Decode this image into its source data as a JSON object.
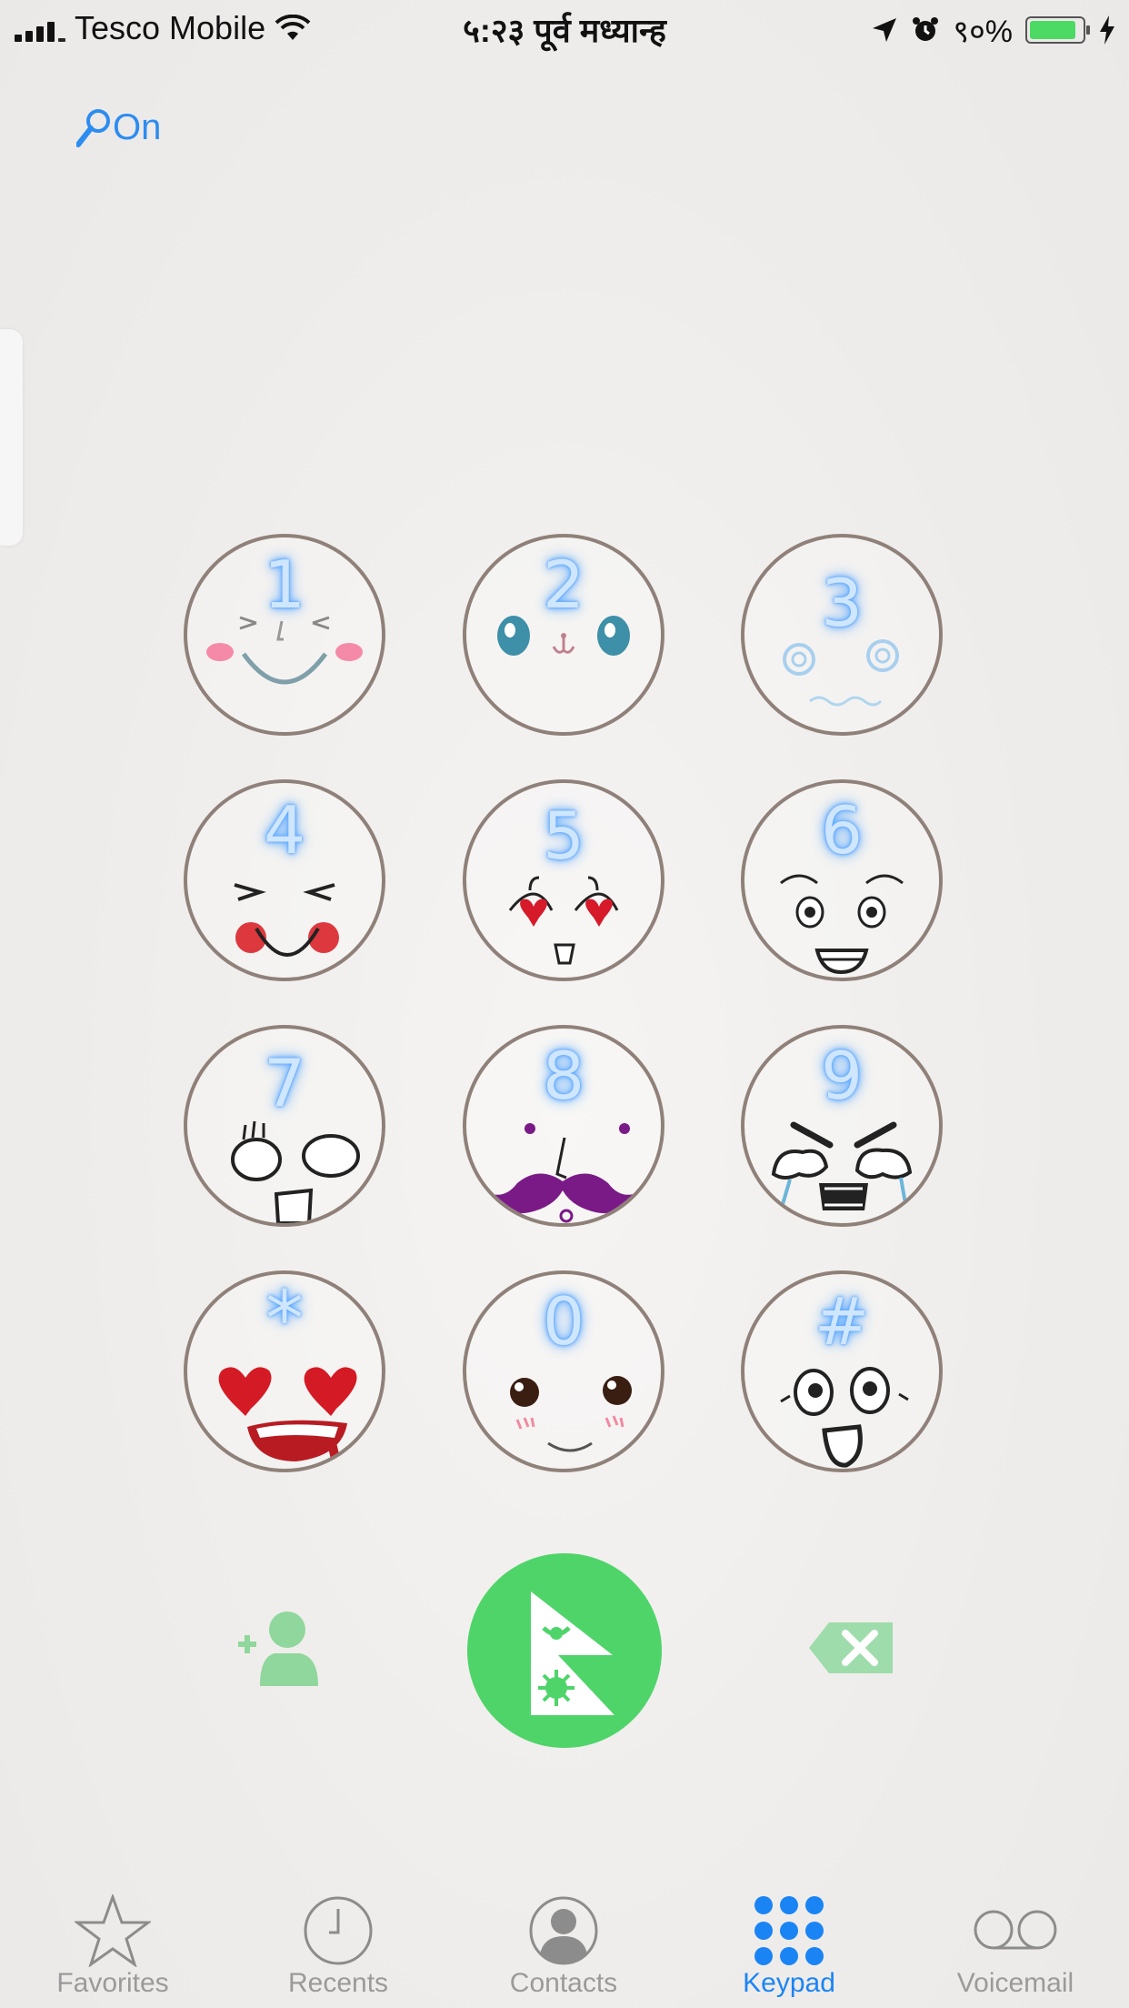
{
  "status_bar": {
    "carrier": "Tesco Mobile",
    "time": "५:२३ पूर्व मध्यान्ह",
    "battery_text": "९०%",
    "battery_level": 0.9
  },
  "search_toggle": {
    "label": "On"
  },
  "keypad": {
    "keys": [
      {
        "digit": "1",
        "face": "happy-squint-face"
      },
      {
        "digit": "2",
        "face": "cute-eyes-face"
      },
      {
        "digit": "3",
        "face": "dizzy-face"
      },
      {
        "digit": "4",
        "face": "blushing-grin-face"
      },
      {
        "digit": "5",
        "face": "heart-eyes-face"
      },
      {
        "digit": "6",
        "face": "grinning-face"
      },
      {
        "digit": "7",
        "face": "shocked-face"
      },
      {
        "digit": "8",
        "face": "mustache-face"
      },
      {
        "digit": "9",
        "face": "angry-crying-face"
      },
      {
        "digit": "*",
        "face": "love-drool-face"
      },
      {
        "digit": "0",
        "face": "blushing-face"
      },
      {
        "digit": "#",
        "face": "surprised-face"
      }
    ]
  },
  "actions": {
    "add_contact_icon": "add-contact-icon",
    "call_icon": "nepal-flag-icon",
    "delete_icon": "delete-icon",
    "call_color": "#4fd46a"
  },
  "tabs": [
    {
      "label": "Favorites",
      "icon": "star-icon"
    },
    {
      "label": "Recents",
      "icon": "clock-icon"
    },
    {
      "label": "Contacts",
      "icon": "contact-icon"
    },
    {
      "label": "Keypad",
      "icon": "keypad-icon",
      "active": true
    },
    {
      "label": "Voicemail",
      "icon": "voicemail-icon"
    }
  ],
  "colors": {
    "accent": "#1a84f5",
    "inactive": "#9a9a9a"
  }
}
